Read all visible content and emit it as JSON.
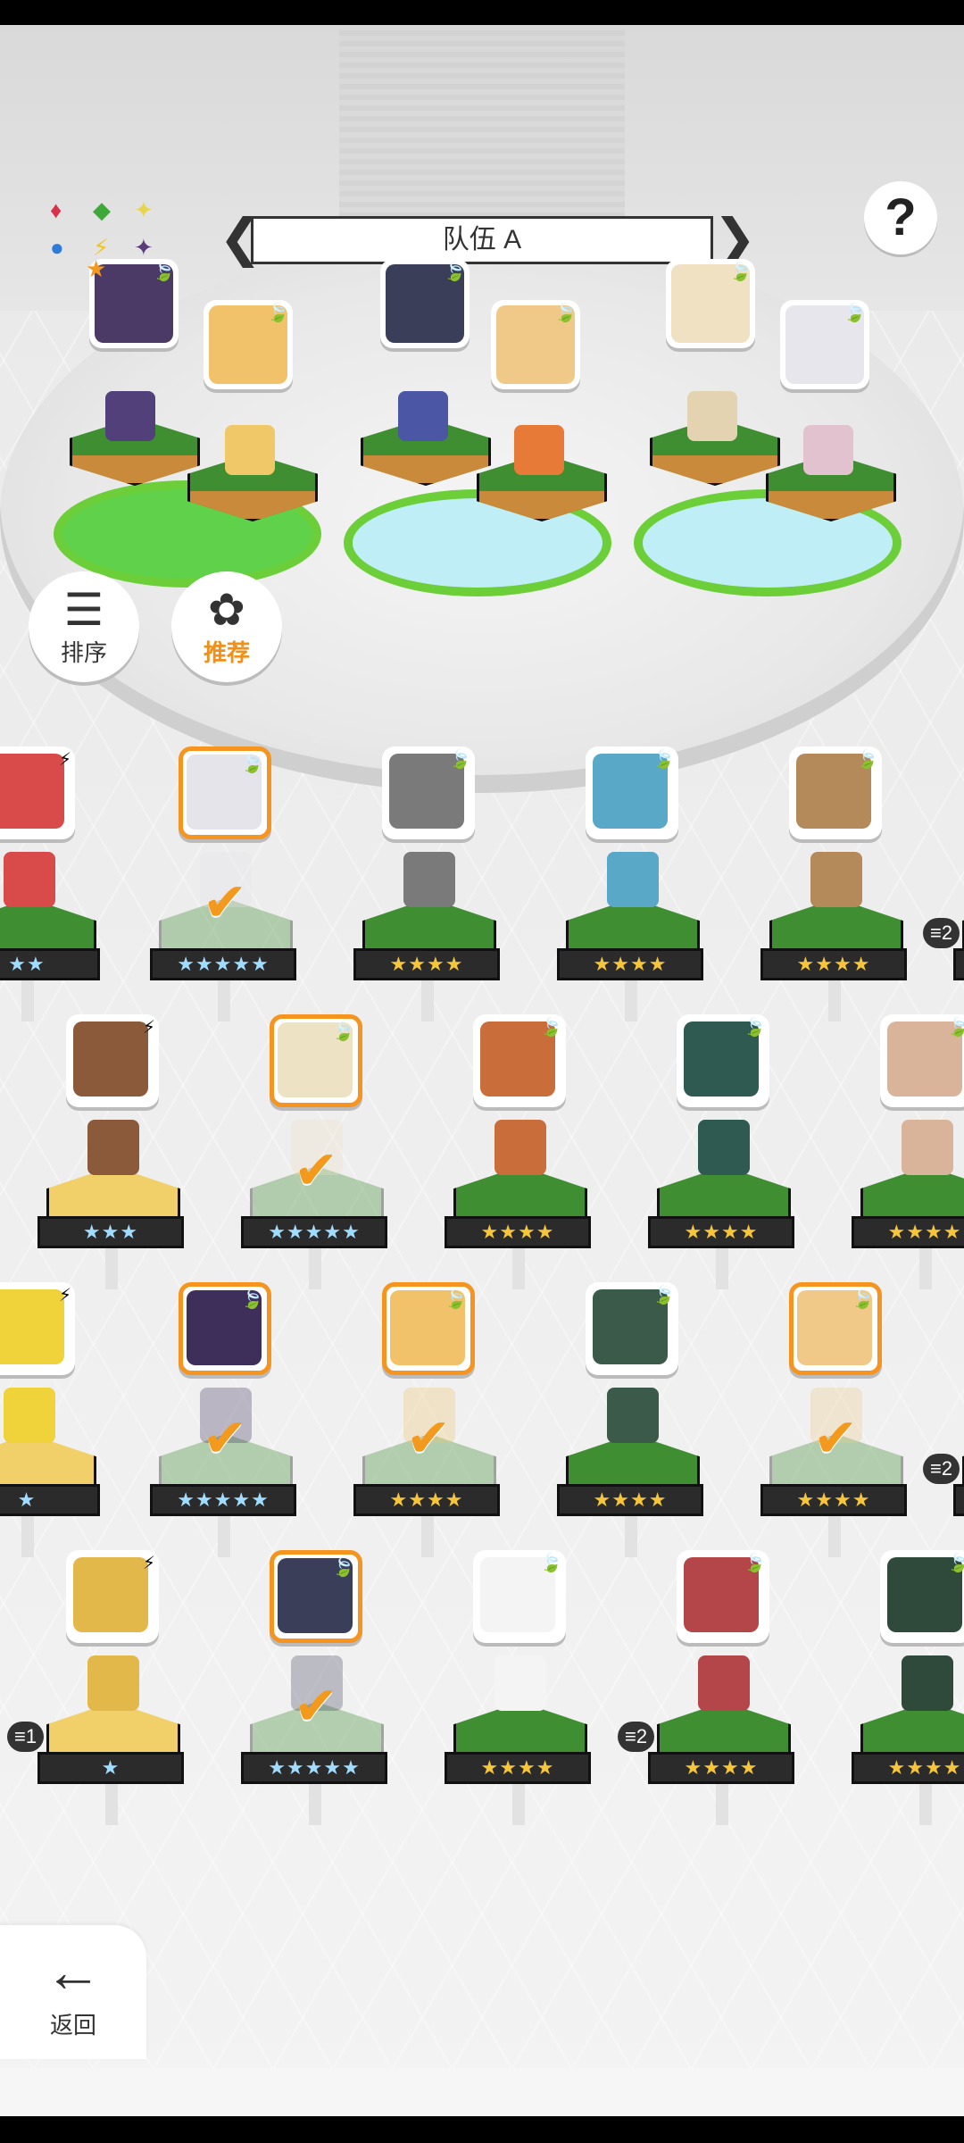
{
  "header": {
    "team_label": "队伍 A",
    "help_glyph": "?",
    "left_arrow": "❮",
    "right_arrow": "❯"
  },
  "element_wheel": [
    "♦",
    "◆",
    "✦",
    "●",
    "⚡",
    "✦"
  ],
  "side_buttons": {
    "sort_label": "排序",
    "recommend_label": "推荐"
  },
  "back_label": "返回",
  "colors": {
    "accent_orange": "#f5941e",
    "leaf_green": "#3fa83a",
    "base_green": "#3f8e32",
    "pool_blue": "#bfeef7"
  },
  "formation": [
    {
      "slot": 1,
      "portrait_color": "#4b3a66",
      "sprite_color": "#51407a"
    },
    {
      "slot": 2,
      "portrait_color": "#f2c26b",
      "sprite_color": "#f1c867"
    },
    {
      "slot": 3,
      "portrait_color": "#3b3e59",
      "sprite_color": "#4b56a5"
    },
    {
      "slot": 4,
      "portrait_color": "#f0c989",
      "sprite_color": "#e87a38"
    },
    {
      "slot": 5,
      "portrait_color": "#efe1c2",
      "sprite_color": "#e3d3b0"
    },
    {
      "slot": 6,
      "portrait_color": "#e6e6ec",
      "sprite_color": "#e2c2cf"
    }
  ],
  "roster": [
    {
      "row": 1,
      "stars": "★★",
      "tier": "blue",
      "selected": false,
      "partial": true,
      "face": "#d94a4a",
      "attr": "⚡"
    },
    {
      "row": 1,
      "stars": "★★★★★",
      "tier": "blue",
      "selected": true,
      "face": "#e4e4ea",
      "attr": "🍃"
    },
    {
      "row": 1,
      "stars": "★★★★",
      "tier": "gold",
      "selected": false,
      "face": "#7a7a7a",
      "attr": "🍃"
    },
    {
      "row": 1,
      "stars": "★★★★",
      "tier": "gold",
      "selected": false,
      "face": "#5aa8c8",
      "attr": "🍃"
    },
    {
      "row": 1,
      "stars": "★★★★",
      "tier": "gold",
      "selected": false,
      "face": "#b58a5a",
      "attr": "🍃"
    },
    {
      "row": 1,
      "stars": "",
      "tier": "gold",
      "selected": false,
      "partial_right": true,
      "face": "#888",
      "dup": "2"
    },
    {
      "row": 2,
      "stars": "★★★",
      "tier": "blue",
      "selected": false,
      "yellow": true,
      "face": "#8a5a3a",
      "attr": "⚡"
    },
    {
      "row": 2,
      "stars": "★★★★★",
      "tier": "blue",
      "selected": true,
      "face": "#eee2c4",
      "attr": "🍃"
    },
    {
      "row": 2,
      "stars": "★★★★",
      "tier": "gold",
      "selected": false,
      "face": "#c96e3a",
      "attr": "🍃"
    },
    {
      "row": 2,
      "stars": "★★★★",
      "tier": "gold",
      "selected": false,
      "face": "#2e5a52",
      "attr": "🍃"
    },
    {
      "row": 2,
      "stars": "★★★★",
      "tier": "gold",
      "selected": false,
      "face": "#d9b49a",
      "attr": "🍃"
    },
    {
      "row": 3,
      "stars": "★",
      "tier": "blue",
      "selected": false,
      "partial": true,
      "yellow": true,
      "face": "#f0d23a",
      "attr": "⚡"
    },
    {
      "row": 3,
      "stars": "★★★★★",
      "tier": "blue",
      "selected": true,
      "face": "#3d2f5a",
      "attr": "🍃"
    },
    {
      "row": 3,
      "stars": "★★★★",
      "tier": "gold",
      "selected": true,
      "face": "#f2c26b",
      "attr": "🍃"
    },
    {
      "row": 3,
      "stars": "★★★★",
      "tier": "gold",
      "selected": false,
      "face": "#3c5a4a",
      "attr": "🍃"
    },
    {
      "row": 3,
      "stars": "★★★★",
      "tier": "gold",
      "selected": true,
      "face": "#f0c989",
      "attr": "🍃"
    },
    {
      "row": 3,
      "stars": "",
      "tier": "gold",
      "selected": false,
      "partial_right": true,
      "face": "#888",
      "dup": "2"
    },
    {
      "row": 4,
      "stars": "★",
      "tier": "blue",
      "selected": false,
      "yellow": true,
      "face": "#e3b84a",
      "attr": "⚡",
      "dup": "1"
    },
    {
      "row": 4,
      "stars": "★★★★★",
      "tier": "blue",
      "selected": true,
      "face": "#3b3e59",
      "attr": "🍃"
    },
    {
      "row": 4,
      "stars": "★★★★",
      "tier": "gold",
      "selected": false,
      "face": "#f4f4f4",
      "attr": "🍃"
    },
    {
      "row": 4,
      "stars": "★★★★",
      "tier": "gold",
      "selected": false,
      "face": "#b4464a",
      "attr": "🍃",
      "dup": "2"
    },
    {
      "row": 4,
      "stars": "★★★★",
      "tier": "gold",
      "selected": false,
      "face": "#2f4a3a",
      "attr": "🍃"
    }
  ]
}
